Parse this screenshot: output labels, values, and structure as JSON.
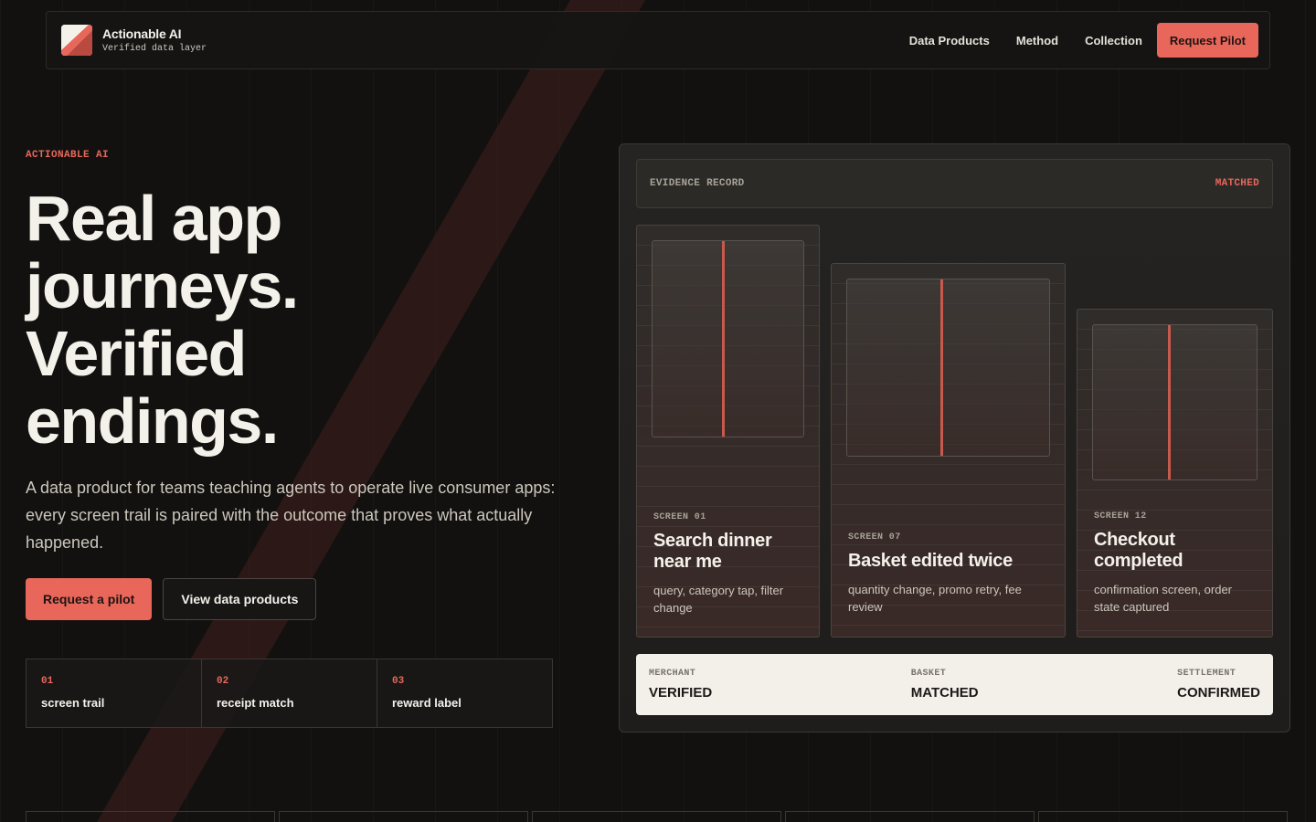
{
  "header": {
    "brand_name": "Actionable AI",
    "brand_tag": "Verified data layer",
    "nav": [
      "Data Products",
      "Method",
      "Collection"
    ],
    "cta": "Request Pilot"
  },
  "hero": {
    "eyebrow": "ACTIONABLE AI",
    "headline": [
      "Real app",
      "journeys.",
      "Verified",
      "endings."
    ],
    "lede": "A data product for teams teaching agents to operate live consumer apps: every screen trail is paired with the outcome that proves what actually happened.",
    "primary_cta": "Request a pilot",
    "secondary_cta": "View data products",
    "steps": [
      {
        "num": "01",
        "label": "screen trail"
      },
      {
        "num": "02",
        "label": "receipt match"
      },
      {
        "num": "03",
        "label": "reward label"
      }
    ]
  },
  "evidence": {
    "label": "EVIDENCE RECORD",
    "status": "MATCHED",
    "screens": [
      {
        "num": "SCREEN 01",
        "title": "Search dinner near me",
        "desc": "query, category tap, filter change"
      },
      {
        "num": "SCREEN 07",
        "title": "Basket edited twice",
        "desc": "quantity change, promo retry, fee review"
      },
      {
        "num": "SCREEN 12",
        "title": "Checkout completed",
        "desc": "confirmation screen, order state captured"
      }
    ],
    "summary": [
      {
        "label": "MERCHANT",
        "value": "VERIFIED"
      },
      {
        "label": "BASKET",
        "value": "MATCHED"
      },
      {
        "label": "SETTLEMENT",
        "value": "CONFIRMED"
      }
    ]
  },
  "colors": {
    "accent": "#e8675a",
    "background": "#121110",
    "text": "#f4f1ea"
  }
}
